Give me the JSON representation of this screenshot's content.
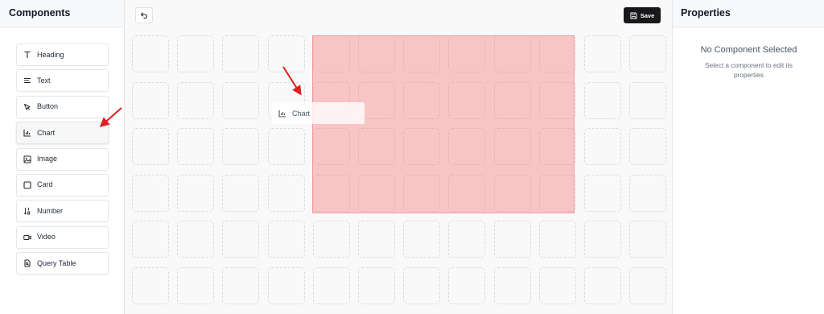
{
  "left_panel": {
    "title": "Components",
    "items": [
      {
        "label": "Heading",
        "icon": "heading-icon"
      },
      {
        "label": "Text",
        "icon": "text-lines-icon"
      },
      {
        "label": "Button",
        "icon": "cursor-pointer-icon"
      },
      {
        "label": "Chart",
        "icon": "bar-chart-icon"
      },
      {
        "label": "Image",
        "icon": "image-icon"
      },
      {
        "label": "Card",
        "icon": "card-square-icon"
      },
      {
        "label": "Number",
        "icon": "number-sort-icon"
      },
      {
        "label": "Video",
        "icon": "video-camera-icon"
      },
      {
        "label": "Query Table",
        "icon": "query-file-icon"
      }
    ]
  },
  "toolbar": {
    "save_label": "Save"
  },
  "canvas": {
    "drag_ghost_label": "Chart"
  },
  "right_panel": {
    "title": "Properties",
    "empty_title": "No Component Selected",
    "empty_subtitle": "Select a component to edit its properties"
  },
  "colors": {
    "save_button_bg": "#18181b",
    "drop_highlight": "#f87171",
    "annotation_arrow": "#e11d1d"
  }
}
